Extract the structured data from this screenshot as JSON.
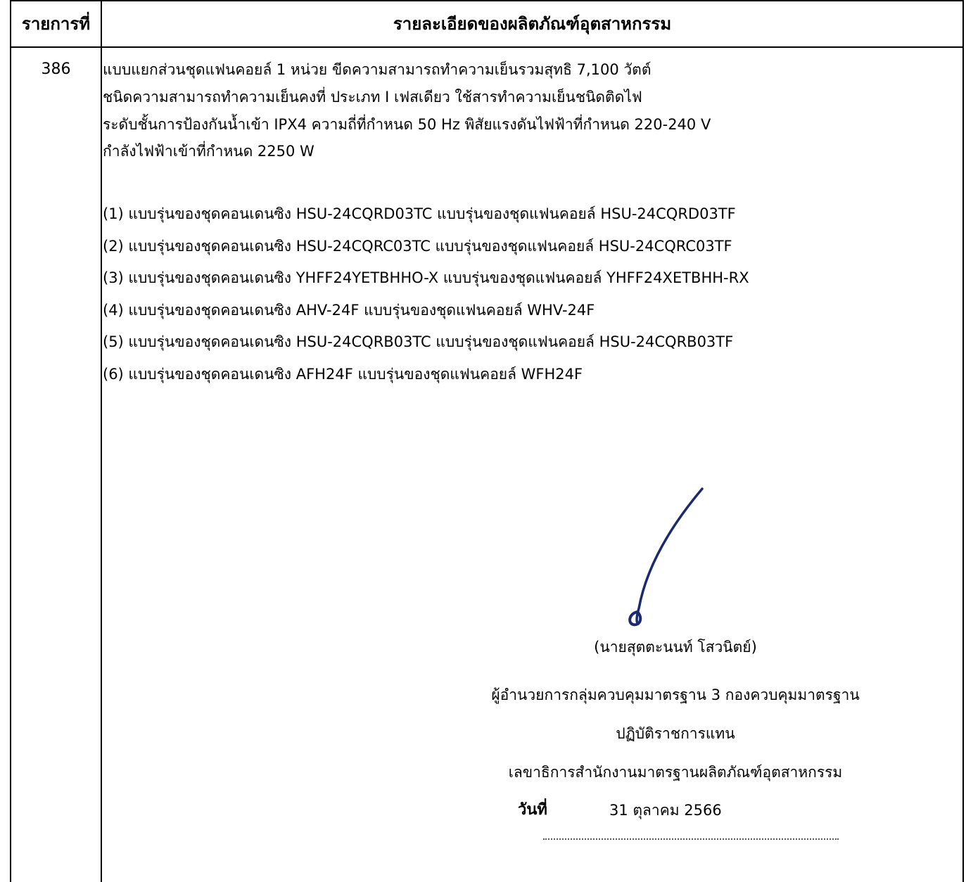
{
  "header": {
    "item_no_label": "รายการที่",
    "detail_label": "รายละเอียดของผลิตภัณฑ์อุตสาหกรรม"
  },
  "item": {
    "number": "386",
    "description_lines": [
      "แบบแยกส่วนชุดแฟนคอยล์ 1 หน่วย ขีดความสามารถทำความเย็นรวมสุทธิ 7,100 วัตต์",
      "ชนิดความสามารถทำความเย็นคงที่ ประเภท I เฟสเดียว ใช้สารทำความเย็นชนิดติดไฟ",
      "ระดับชั้นการป้องกันน้ำเข้า IPX4 ความถี่ที่กำหนด 50 Hz พิสัยแรงดันไฟฟ้าที่กำหนด 220-240 V",
      "กำลังไฟฟ้าเข้าที่กำหนด 2250 W"
    ],
    "model_lines": [
      "(1) แบบรุ่นของชุดคอนเดนซิง HSU-24CQRD03TC แบบรุ่นของชุดแฟนคอยล์ HSU-24CQRD03TF",
      "(2) แบบรุ่นของชุดคอนเดนซิง HSU-24CQRC03TC แบบรุ่นของชุดแฟนคอยล์ HSU-24CQRC03TF",
      "(3) แบบรุ่นของชุดคอนเดนซิง YHFF24YETBHHO-X แบบรุ่นของชุดแฟนคอยล์ YHFF24XETBHH-RX",
      "(4) แบบรุ่นของชุดคอนเดนซิง AHV-24F แบบรุ่นของชุดแฟนคอยล์ WHV-24F",
      "(5) แบบรุ่นของชุดคอนเดนซิง HSU-24CQRB03TC แบบรุ่นของชุดแฟนคอยล์ HSU-24CQRB03TF",
      "(6) แบบรุ่นของชุดคอนเดนซิง AFH24F แบบรุ่นของชุดแฟนคอยล์ WFH24F"
    ]
  },
  "signatory": {
    "name": "(นายสุตตะนนท์ โสวนิตย์)",
    "position_line1": "ผู้อำนวยการกลุ่มควบคุมมาตรฐาน 3 กองควบคุมมาตรฐาน",
    "position_line2": "ปฏิบัติราชการแทน",
    "position_line3": "เลขาธิการสำนักงานมาตรฐานผลิตภัณฑ์อุตสาหกรรม",
    "date_label": "วันที่",
    "date_value": "31 ตุลาคม 2566",
    "signature_ink_color": "#1a2a6e"
  }
}
